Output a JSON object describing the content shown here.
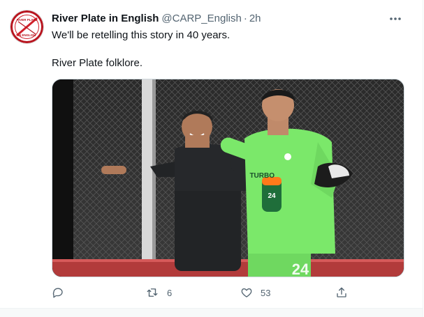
{
  "tweet": {
    "display_name": "River Plate in English",
    "handle": "@CARP_English",
    "separator": "·",
    "time": "2h",
    "text_lines": [
      "We'll be retelling this story in 40 years.",
      "River Plate folklore."
    ],
    "avatar_text": [
      "RIVER PLATE",
      "IN ENGLISH"
    ],
    "media_jersey_number": "24",
    "media_bottle_number": "24",
    "media_bottle_text": "TURBO",
    "actions": {
      "reply_count": "",
      "retweet_count": "6",
      "like_count": "53"
    }
  },
  "colors": {
    "text_primary": "#0f1419",
    "text_secondary": "#536471",
    "keeper_kit": "#7be86a",
    "avatar_red": "#d0202a"
  },
  "icons": [
    "more-icon",
    "reply-icon",
    "retweet-icon",
    "like-icon",
    "share-icon"
  ]
}
